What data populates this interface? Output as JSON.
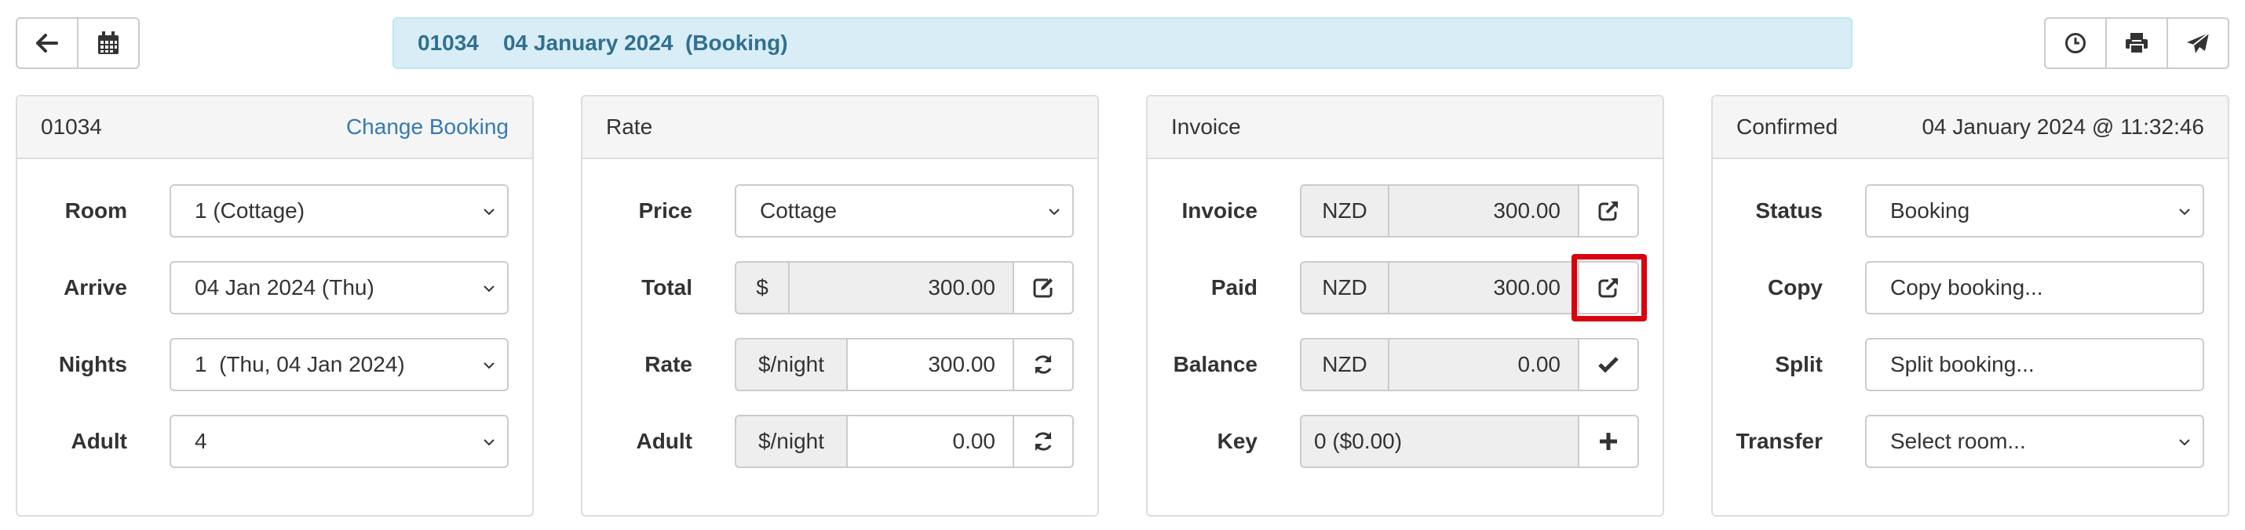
{
  "header": {
    "booking_id": "01034",
    "date": "04 January 2024",
    "type": "(Booking)",
    "icons": [
      "arrow-left-icon",
      "calendar-icon",
      "clock-icon",
      "printer-icon",
      "paper-plane-icon"
    ]
  },
  "booking_panel": {
    "id": "01034",
    "change_link": "Change Booking",
    "rows": [
      {
        "label": "Room",
        "value": "1 (Cottage)"
      },
      {
        "label": "Arrive",
        "value": "04 Jan 2024 (Thu)"
      },
      {
        "label": "Nights",
        "value": "1  (Thu, 04 Jan 2024)"
      },
      {
        "label": "Adult",
        "value": "4"
      }
    ]
  },
  "rate_panel": {
    "title": "Rate",
    "price_label": "Price",
    "price_value": "Cottage",
    "total_label": "Total",
    "total_currency": "$",
    "total_value": "300.00",
    "rate_label": "Rate",
    "rate_unit": "$/night",
    "rate_value": "300.00",
    "adult_label": "Adult",
    "adult_unit": "$/night",
    "adult_value": "0.00"
  },
  "invoice_panel": {
    "title": "Invoice",
    "invoice_label": "Invoice",
    "invoice_currency": "NZD",
    "invoice_value": "300.00",
    "paid_label": "Paid",
    "paid_currency": "NZD",
    "paid_value": "300.00",
    "balance_label": "Balance",
    "balance_currency": "NZD",
    "balance_value": "0.00",
    "key_label": "Key",
    "key_value": "0 ($0.00)"
  },
  "status_panel": {
    "title": "Confirmed",
    "timestamp": "04 January 2024 @ 11:32:46",
    "status_label": "Status",
    "status_value": "Booking",
    "copy_label": "Copy",
    "copy_value": "Copy booking...",
    "split_label": "Split",
    "split_value": "Split booking...",
    "transfer_label": "Transfer",
    "transfer_value": "Select room..."
  },
  "colors": {
    "title_bg": "#d9edf7",
    "title_text": "#31708f",
    "link": "#337ab7",
    "highlight": "#d9000f"
  }
}
